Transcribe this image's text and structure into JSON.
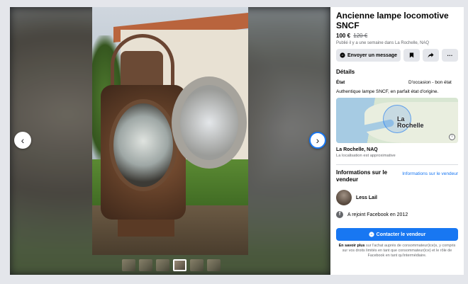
{
  "viewer": {
    "prev_icon": "chevron-left-icon",
    "next_icon": "chevron-right-icon",
    "prev_glyph": "‹",
    "next_glyph": "›",
    "thumbnail_count": 6,
    "active_thumbnail": 4
  },
  "listing": {
    "title": "Ancienne lampe locomotive SNCF",
    "price": "100 €",
    "old_price": "120 €",
    "posted": "Publié il y a une semaine dans La Rochelle, NAQ"
  },
  "actions": {
    "message_label": "Envoyer un message",
    "message_icon": "messenger-icon",
    "save_icon": "bookmark-icon",
    "share_icon": "share-icon",
    "more_icon": "more-icon",
    "more_glyph": "···"
  },
  "details": {
    "heading": "Détails",
    "condition_label": "État",
    "condition_value": "D'occasion - bon état",
    "description": "Authentique lampe SNCF, en parfait état d'origine."
  },
  "map": {
    "city_label_line1": "La",
    "city_label_line2": "Rochelle",
    "info_glyph": "i",
    "location_name": "La Rochelle, NAQ",
    "location_note": "La localisation est approximative"
  },
  "seller": {
    "heading": "Informations sur le vendeur",
    "details_link": "Informations sur le vendeur",
    "name": "Less Lail",
    "joined": "A rejoint Facebook en 2012",
    "facebook_glyph": "f"
  },
  "contact": {
    "button_label": "Contacter le vendeur",
    "fine_bold": "En savoir plus",
    "fine_rest": " sur l'achat auprès de consommateur(ice)s, y compris sur vos droits limités en tant que consommateur(ice) et le rôle de Facebook en tant qu'intermédiaire."
  },
  "colors": {
    "accent": "#1877f2",
    "page_bg": "#e4e6eb",
    "secondary_text": "#65676b"
  }
}
